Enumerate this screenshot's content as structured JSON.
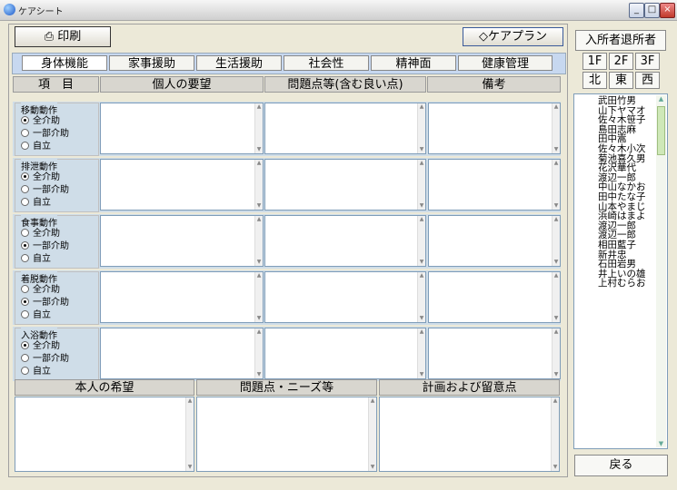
{
  "window": {
    "title": "ケアシート"
  },
  "toolbar": {
    "print_label": "印刷",
    "careplan_label": "ケアプラン"
  },
  "tabs": [
    "身体機能",
    "家事援助",
    "生活援助",
    "社会性",
    "精神面",
    "健康管理"
  ],
  "headers": {
    "item": "項　目",
    "request": "個人の要望",
    "problems": "問題点等(含む良い点)",
    "notes": "備考"
  },
  "radio_options": [
    "全介助",
    "一部介助",
    "自立"
  ],
  "rows": [
    {
      "label": "移動動作",
      "selected": 0
    },
    {
      "label": "排泄動作",
      "selected": 0
    },
    {
      "label": "食事動作",
      "selected": 1
    },
    {
      "label": "着脱動作",
      "selected": 1
    },
    {
      "label": "入浴動作",
      "selected": 0
    }
  ],
  "bottom_headers": {
    "wish": "本人の希望",
    "needs": "問題点・ニーズ等",
    "plan": "計画および留意点"
  },
  "right": {
    "status_label": "入所者退所者",
    "floors": [
      "1F",
      "2F",
      "3F"
    ],
    "wings": [
      "北",
      "東",
      "西"
    ],
    "residents": [
      "武田竹男",
      "山下ヤマオ",
      "佐々木笹子",
      "島田志麻",
      "田中嵩",
      "佐々木小次",
      "菊池喜久男",
      "花沢華代",
      "渡辺一郎",
      "中山なかお",
      "田中たな子",
      "山本やまじ",
      "浜崎はまよ",
      "渡辺一郎",
      "渡辺一郎",
      "相田藍子",
      "新井忠",
      "石田岩男",
      "井上いの雄",
      "上村むらお"
    ],
    "back_label": "戻る"
  }
}
